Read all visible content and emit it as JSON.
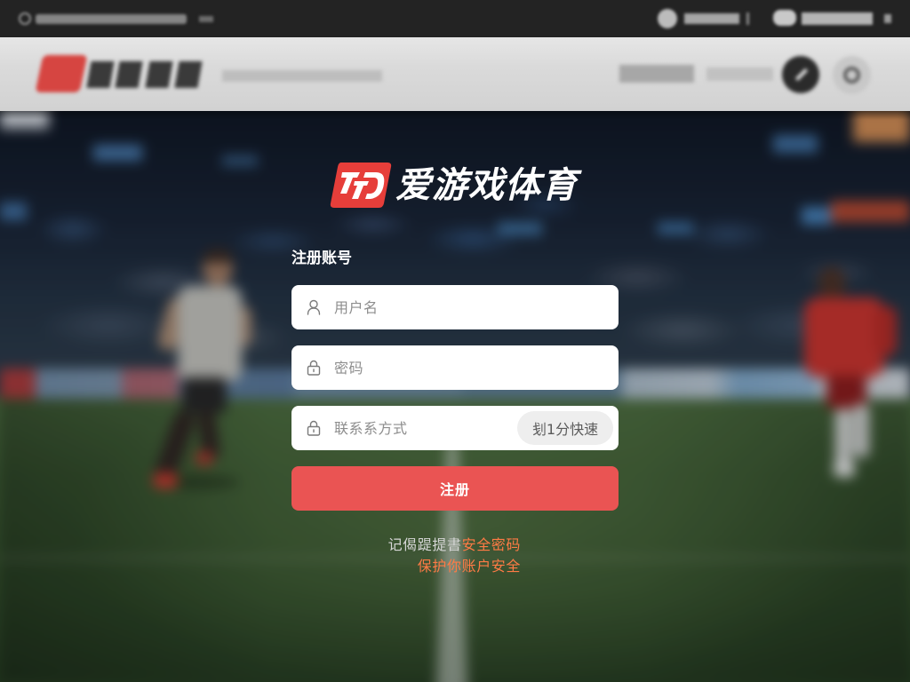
{
  "brand": {
    "logo_text": "爱游戏体育",
    "logo_icon": "brand-d-logo-icon"
  },
  "form": {
    "title": "注册账号",
    "username": {
      "placeholder": "用户名",
      "value": "",
      "icon": "user-icon"
    },
    "password": {
      "placeholder": "密码",
      "value": "",
      "icon": "lock-icon"
    },
    "contact": {
      "placeholder": "联系系方式",
      "value": "",
      "icon": "lock-icon",
      "quick_button_label": "刬1分快速"
    },
    "submit_label": "注册"
  },
  "notice": {
    "line1_text": "记偈踶提書",
    "line1_highlight": "安全密码",
    "line2_highlight": "保护你账户安全"
  },
  "colors": {
    "submit_button": "#ea5453",
    "highlight_text": "#ff7b45",
    "input_background": "#ffffff",
    "quick_button_background": "#eeeeee",
    "logo_red": "#e63e3a",
    "top_bar": "#232323",
    "header": "#dadada"
  }
}
